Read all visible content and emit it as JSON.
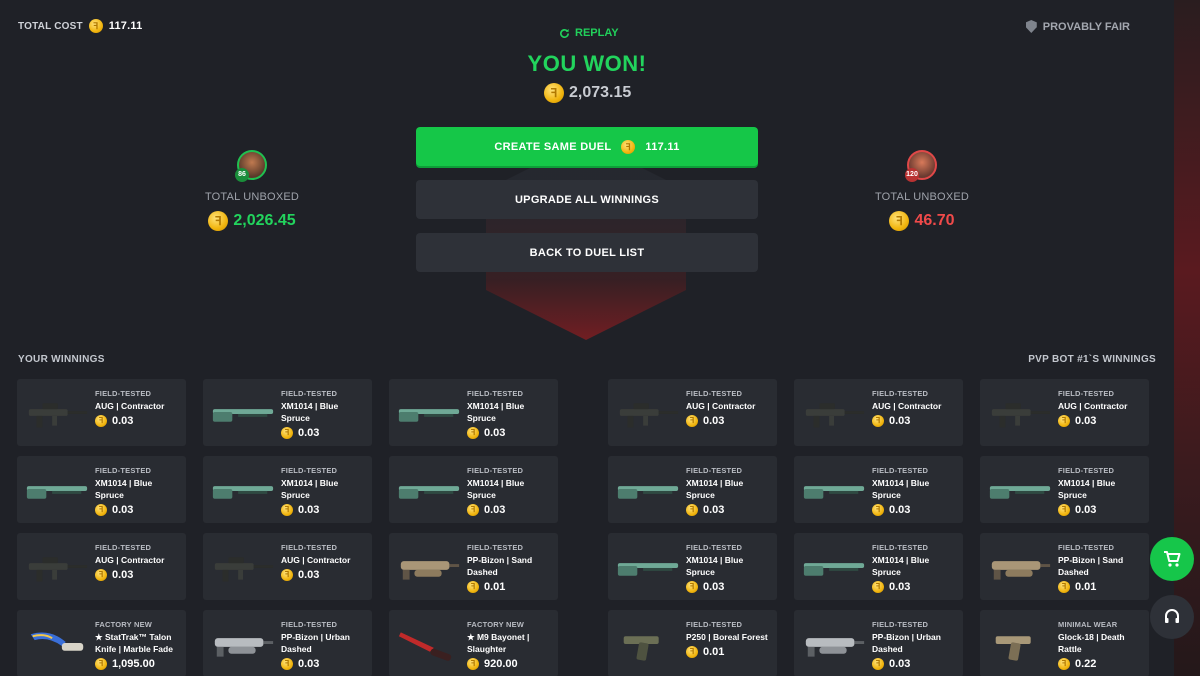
{
  "header": {
    "total_cost_label": "TOTAL COST",
    "total_cost_value": "117.11",
    "fair_label": "PROVABLY FAIR",
    "replay_label": "REPLAY"
  },
  "result": {
    "title": "YOU WON!",
    "amount": "2,073.15"
  },
  "actions": {
    "create_label": "CREATE SAME DUEL",
    "create_price": "117.11",
    "upgrade_label": "UPGRADE ALL WINNINGS",
    "back_label": "BACK TO DUEL LIST"
  },
  "players": {
    "left": {
      "level": "86",
      "label": "TOTAL UNBOXED",
      "value": "2,026.45"
    },
    "right": {
      "level": "120",
      "label": "TOTAL UNBOXED",
      "value": "46.70"
    }
  },
  "sections": {
    "left_title": "YOUR WINNINGS",
    "right_title": "PVP BOT #1`S WINNINGS"
  },
  "colors": {
    "accent_green": "#15c748",
    "win_green": "#22d45d",
    "loss_red": "#f04a4a",
    "coin_gold": "#f1b50e"
  },
  "left_items": [
    {
      "cond": "FIELD-TESTED",
      "name": "AUG | Contractor",
      "price": "0.03",
      "icon": "aug"
    },
    {
      "cond": "FIELD-TESTED",
      "name": "XM1014 | Blue Spruce",
      "price": "0.03",
      "icon": "xm"
    },
    {
      "cond": "FIELD-TESTED",
      "name": "XM1014 | Blue Spruce",
      "price": "0.03",
      "icon": "xm"
    },
    {
      "cond": "FIELD-TESTED",
      "name": "XM1014 | Blue Spruce",
      "price": "0.03",
      "icon": "xm"
    },
    {
      "cond": "FIELD-TESTED",
      "name": "XM1014 | Blue Spruce",
      "price": "0.03",
      "icon": "xm"
    },
    {
      "cond": "FIELD-TESTED",
      "name": "XM1014 | Blue Spruce",
      "price": "0.03",
      "icon": "xm"
    },
    {
      "cond": "FIELD-TESTED",
      "name": "AUG | Contractor",
      "price": "0.03",
      "icon": "aug"
    },
    {
      "cond": "FIELD-TESTED",
      "name": "AUG | Contractor",
      "price": "0.03",
      "icon": "aug"
    },
    {
      "cond": "FIELD-TESTED",
      "name": "PP-Bizon | Sand Dashed",
      "price": "0.01",
      "icon": "bizon"
    },
    {
      "cond": "FACTORY NEW",
      "name": "★ StatTrak™ Talon Knife | Marble Fade",
      "price": "1,095.00",
      "icon": "talon"
    },
    {
      "cond": "FIELD-TESTED",
      "name": "PP-Bizon | Urban Dashed",
      "price": "0.03",
      "icon": "bizon-urban"
    },
    {
      "cond": "FACTORY NEW",
      "name": "★ M9 Bayonet | Slaughter",
      "price": "920.00",
      "icon": "m9"
    }
  ],
  "right_items": [
    {
      "cond": "FIELD-TESTED",
      "name": "AUG | Contractor",
      "price": "0.03",
      "icon": "aug"
    },
    {
      "cond": "FIELD-TESTED",
      "name": "AUG | Contractor",
      "price": "0.03",
      "icon": "aug"
    },
    {
      "cond": "FIELD-TESTED",
      "name": "AUG | Contractor",
      "price": "0.03",
      "icon": "aug"
    },
    {
      "cond": "FIELD-TESTED",
      "name": "XM1014 | Blue Spruce",
      "price": "0.03",
      "icon": "xm"
    },
    {
      "cond": "FIELD-TESTED",
      "name": "XM1014 | Blue Spruce",
      "price": "0.03",
      "icon": "xm"
    },
    {
      "cond": "FIELD-TESTED",
      "name": "XM1014 | Blue Spruce",
      "price": "0.03",
      "icon": "xm"
    },
    {
      "cond": "FIELD-TESTED",
      "name": "XM1014 | Blue Spruce",
      "price": "0.03",
      "icon": "xm"
    },
    {
      "cond": "FIELD-TESTED",
      "name": "XM1014 | Blue Spruce",
      "price": "0.03",
      "icon": "xm"
    },
    {
      "cond": "FIELD-TESTED",
      "name": "PP-Bizon | Sand Dashed",
      "price": "0.01",
      "icon": "bizon"
    },
    {
      "cond": "FIELD-TESTED",
      "name": "P250 | Boreal Forest",
      "price": "0.01",
      "icon": "p250"
    },
    {
      "cond": "FIELD-TESTED",
      "name": "PP-Bizon | Urban Dashed",
      "price": "0.03",
      "icon": "bizon-urban"
    },
    {
      "cond": "MINIMAL WEAR",
      "name": "Glock-18 | Death Rattle",
      "price": "0.22",
      "icon": "glock"
    }
  ]
}
